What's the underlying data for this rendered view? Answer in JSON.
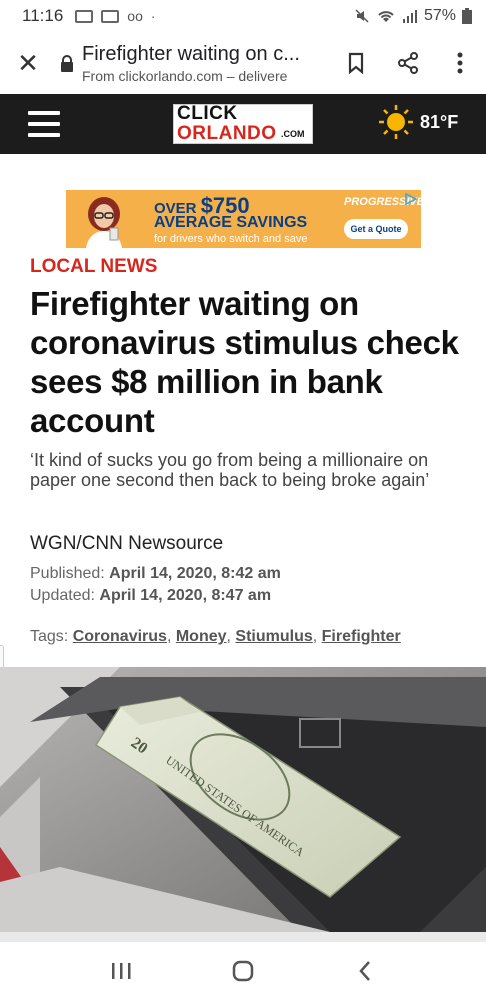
{
  "status_bar": {
    "time": "11:16",
    "battery": "57%"
  },
  "tab": {
    "title": "Firefighter waiting on c...",
    "url": "From clickorlando.com – delivere"
  },
  "site": {
    "logo_line1": "CLICK",
    "logo_line2": "ORLANDO",
    "logo_suffix": ".COM",
    "temperature": "81°F"
  },
  "ad": {
    "line1_prefix": "OVER",
    "line1_amount": "$750",
    "line2": "AVERAGE SAVINGS",
    "line3": "for drivers who switch and save",
    "brand": "PROGRESSIVE",
    "cta": "Get a Quote"
  },
  "article": {
    "kicker": "LOCAL NEWS",
    "headline": "Firefighter waiting on coronavirus stimulus check sees $8 million in bank account",
    "dek": "‘It kind of sucks you go from being a millionaire on paper one second then back to being broke again’",
    "byline": "WGN/CNN Newsource",
    "published_label": "Published:",
    "published_value": "April 14, 2020, 8:42 am",
    "updated_label": "Updated:",
    "updated_value": "April 14, 2020, 8:47 am",
    "tags_label": "Tags:",
    "tags": [
      "Coronavirus",
      "Money",
      "Stiumulus",
      "Firefighter"
    ]
  },
  "colors": {
    "accent_red": "#d9261c",
    "header_bg": "#1c1c1c",
    "ad_orange": "#f5b04a",
    "ad_blue": "#0a3f86"
  },
  "icons": {
    "status": [
      "image-icon",
      "mail-icon",
      "voicemail-icon",
      "dot-icon",
      "mute-icon",
      "wifi-icon",
      "signal-icon",
      "battery-icon"
    ],
    "tab": [
      "close-icon",
      "lock-icon",
      "bookmark-icon",
      "share-icon",
      "more-vert-icon"
    ],
    "nav": [
      "recent-apps-icon",
      "home-icon",
      "back-icon"
    ]
  }
}
